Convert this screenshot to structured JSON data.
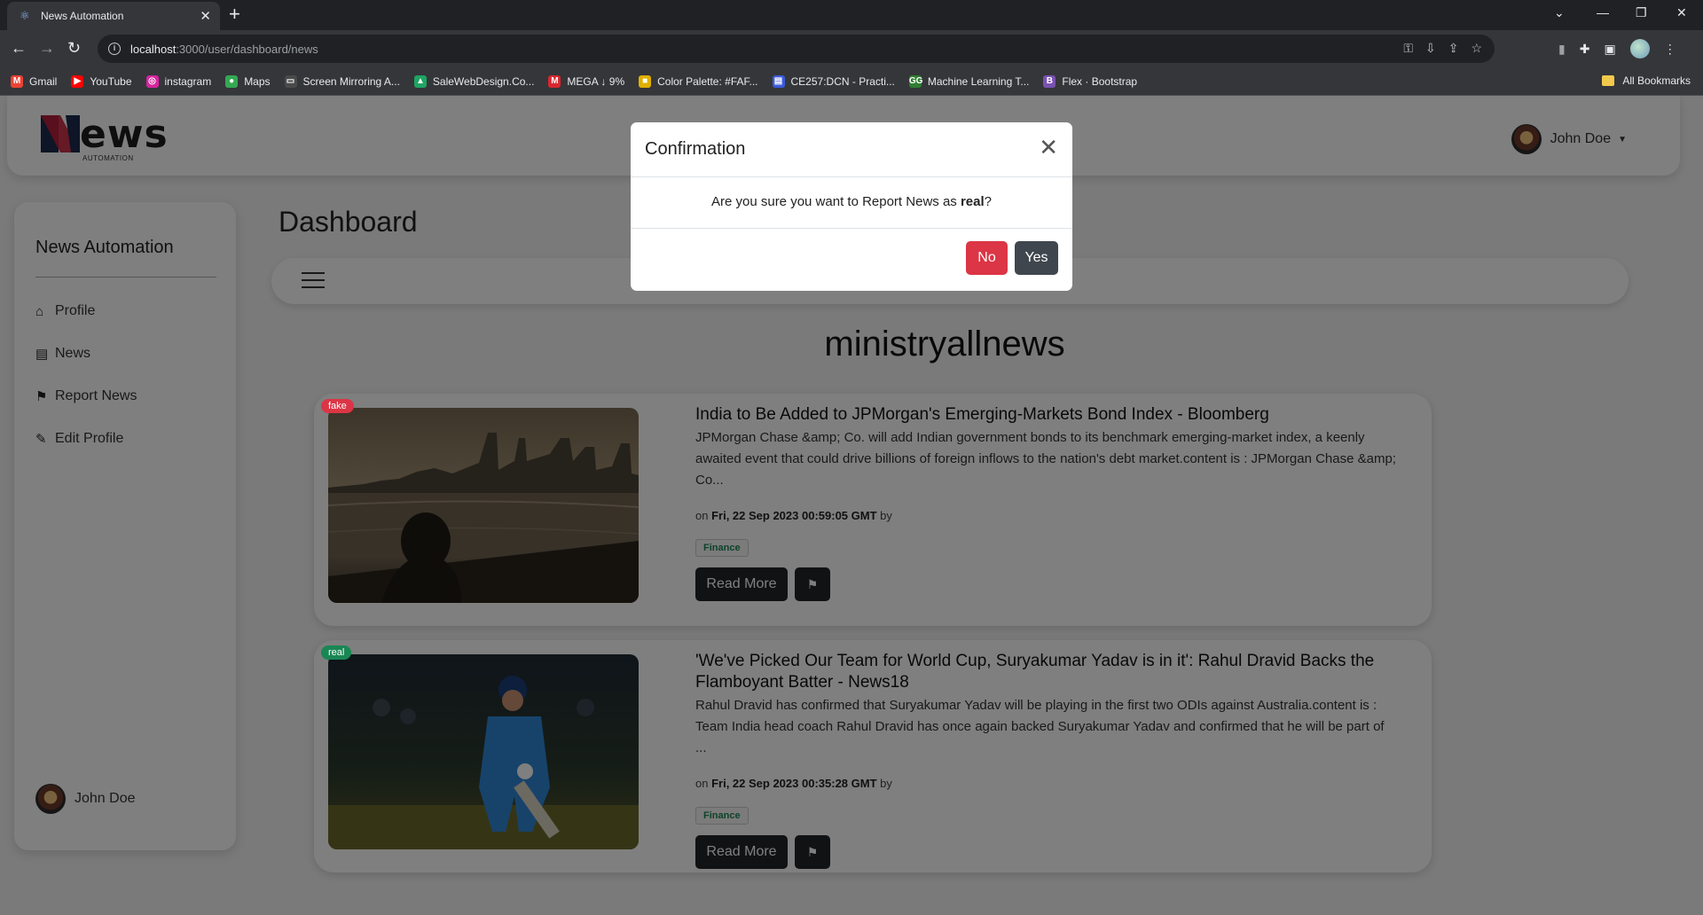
{
  "browser": {
    "tab_title": "News Automation",
    "url_host": "localhost",
    "url_rest": ":3000/user/dashboard/news",
    "bookmarks": [
      {
        "label": "Gmail",
        "icon": "gmail-icon",
        "color": "#ea4335",
        "glyph": "M"
      },
      {
        "label": "YouTube",
        "icon": "youtube-icon",
        "color": "#ff0000",
        "glyph": "▶"
      },
      {
        "label": "instagram",
        "icon": "instagram-icon",
        "color": "#d6249f",
        "glyph": "◎"
      },
      {
        "label": "Maps",
        "icon": "maps-icon",
        "color": "#34a853",
        "glyph": "●"
      },
      {
        "label": "Screen Mirroring A...",
        "icon": "screen-mirroring-icon",
        "color": "#4a4a4a",
        "glyph": "▭"
      },
      {
        "label": "SaleWebDesign.Co...",
        "icon": "drive-icon",
        "color": "#1fa463",
        "glyph": "▲"
      },
      {
        "label": "MEGA ↓ 9%",
        "icon": "mega-icon",
        "color": "#d9272e",
        "glyph": "M"
      },
      {
        "label": "Color Palette: #FAF...",
        "icon": "color-palette-icon",
        "color": "#e0b000",
        "glyph": "■"
      },
      {
        "label": "CE257:DCN - Practi...",
        "icon": "classroom-icon",
        "color": "#3b5bdb",
        "glyph": "▤"
      },
      {
        "label": "Machine Learning T...",
        "icon": "ml-icon",
        "color": "#2e7d32",
        "glyph": "GG"
      },
      {
        "label": "Flex · Bootstrap",
        "icon": "bootstrap-icon",
        "color": "#7952b3",
        "glyph": "B"
      }
    ],
    "all_bookmarks": "All Bookmarks"
  },
  "header": {
    "logo_word": "ews",
    "logo_sub": "AUTOMATION",
    "user_name": "John Doe"
  },
  "sidebar": {
    "title": "News Automation",
    "items": [
      {
        "label": "Profile",
        "icon": "home-icon"
      },
      {
        "label": "News",
        "icon": "newspaper-icon"
      },
      {
        "label": "Report News",
        "icon": "flag-icon"
      },
      {
        "label": "Edit Profile",
        "icon": "edit-icon"
      }
    ],
    "user_name": "John Doe"
  },
  "main": {
    "title": "Dashboard",
    "channel": "ministryallnews",
    "cards": [
      {
        "badge": "fake",
        "title": "India to Be Added to JPMorgan's Emerging-Markets Bond Index - Bloomberg",
        "body": "JPMorgan Chase &amp; Co. will add Indian government bonds to its benchmark emerging-market index, a keenly awaited event that could drive billions of foreign inflows to the nation's debt market.content is : JPMorgan Chase &amp; Co...",
        "meta_prefix": "on",
        "date": "Fri, 22 Sep 2023 00:59:05 GMT",
        "meta_suffix": "by",
        "tag": "Finance",
        "read_more": "Read More"
      },
      {
        "badge": "real",
        "title": "'We've Picked Our Team for World Cup, Suryakumar Yadav is in it': Rahul Dravid Backs the Flamboyant Batter - News18",
        "body": "Rahul Dravid has confirmed that Suryakumar Yadav will be playing in the first two ODIs against Australia.content is : Team India head coach Rahul Dravid has once again backed Suryakumar Yadav and confirmed that he will be part of ...",
        "meta_prefix": "on",
        "date": "Fri, 22 Sep 2023 00:35:28 GMT",
        "meta_suffix": "by",
        "tag": "Finance",
        "read_more": "Read More"
      }
    ]
  },
  "modal": {
    "title": "Confirmation",
    "question_prefix": "Are you sure you want to Report News as ",
    "question_emph": "real",
    "question_suffix": "?",
    "no_label": "No",
    "yes_label": "Yes"
  },
  "colors": {
    "fake": "#dc3545",
    "real": "#198754",
    "dark_button": "#212529"
  }
}
